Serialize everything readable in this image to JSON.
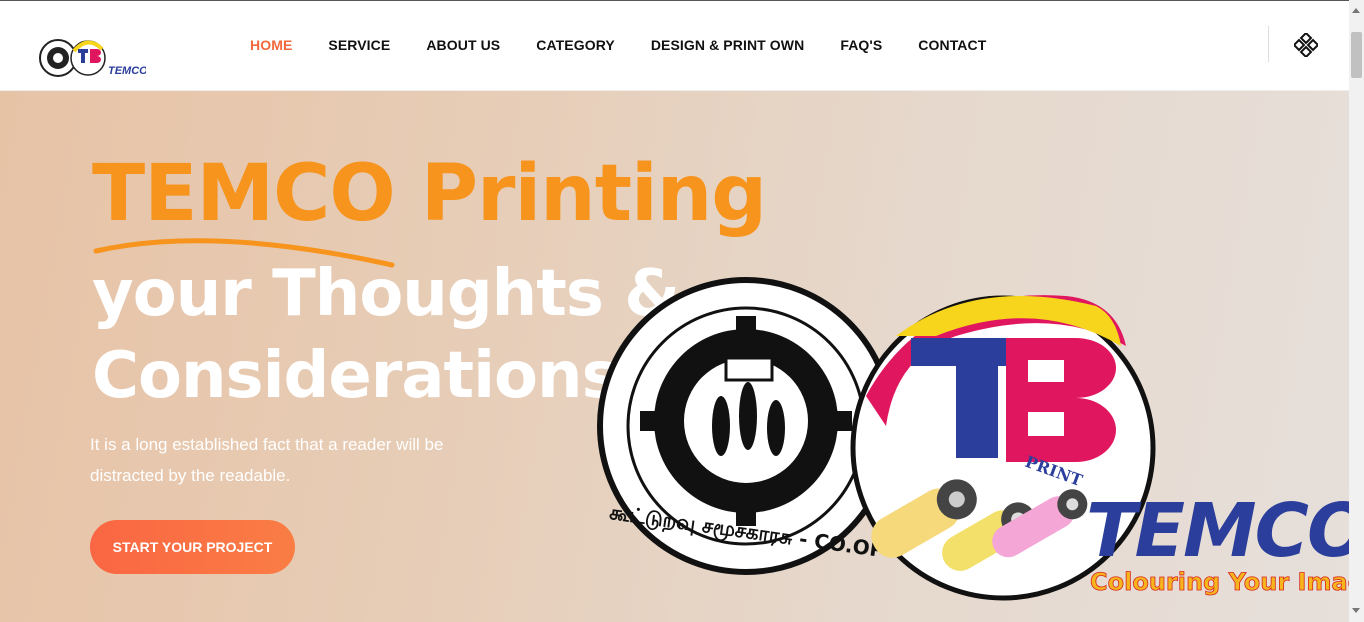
{
  "nav": {
    "items": [
      "HOME",
      "SERVICE",
      "ABOUT US",
      "CATEGORY",
      "DESIGN & PRINT OWN",
      "FAQ'S",
      "CONTACT"
    ],
    "active": "HOME"
  },
  "hero": {
    "headline_orange": "TEMCO Printing",
    "headline_white_1": "your Thoughts &",
    "headline_white_2": "Considerations",
    "subtext": "It is a long established fact that a reader will be distracted by the readable.",
    "cta_label": "START YOUR PROJECT"
  },
  "logo": {
    "brand_text": "TEMCO",
    "tagline": "Colouring Your Imagination",
    "print_word": "PRINT",
    "seal_text": "கூட்டுறவு சமூசகாரசு - CO.OP"
  },
  "colors": {
    "accent": "#f2673b",
    "orange": "#f7941d",
    "brand_blue": "#2b3e9c",
    "brand_pink": "#e0175f"
  }
}
